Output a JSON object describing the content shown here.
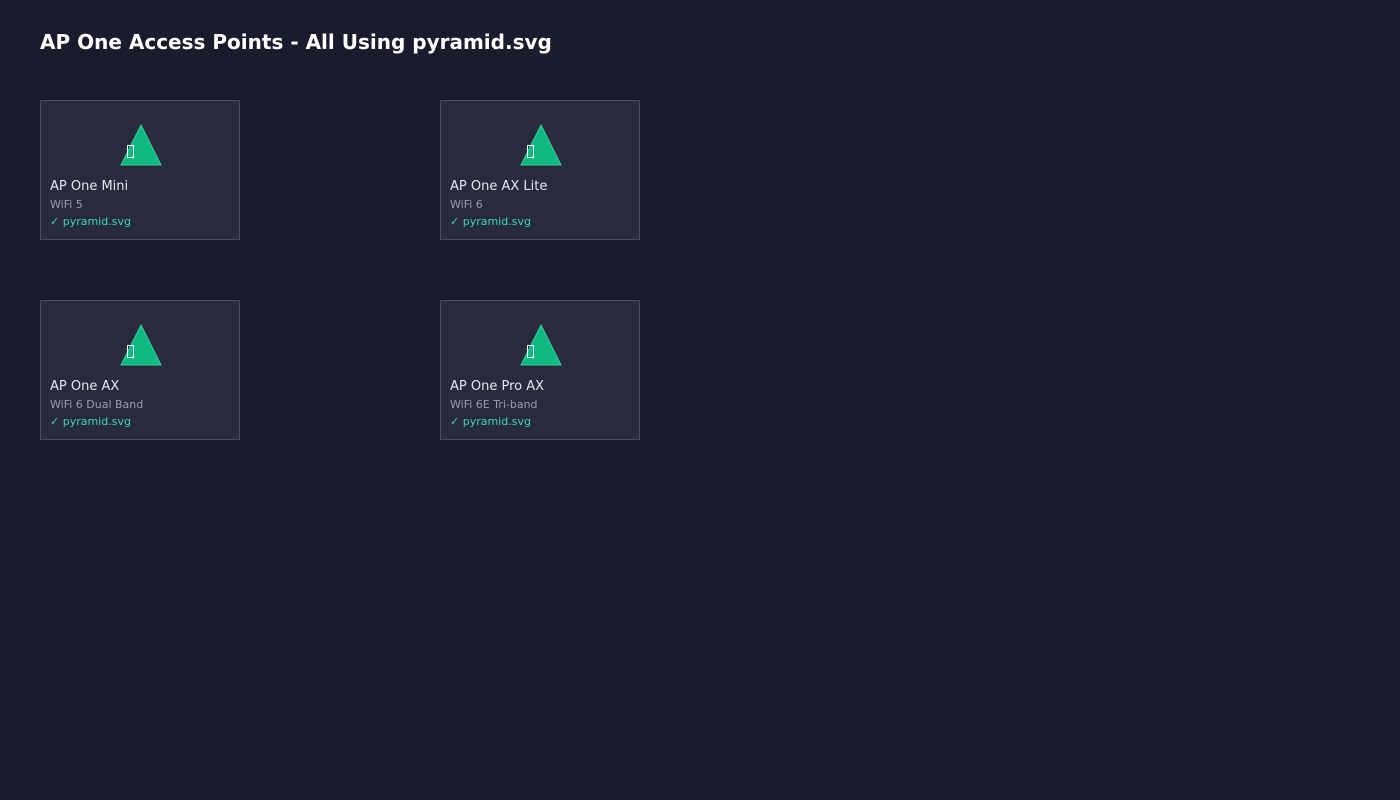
{
  "page": {
    "title": "AP One Access Points - All Using pyramid.svg"
  },
  "colors": {
    "background": "#1b1b2e",
    "card_background": "#282a3d",
    "card_border": "#4a4c66",
    "pyramid_fill": "#10b981",
    "check_text": "#3fd6b0"
  },
  "devices": [
    {
      "name": "AP One Mini",
      "spec": "WiFi 5",
      "file": "✓ pyramid.svg",
      "icon": "pyramid-icon"
    },
    {
      "name": "AP One AX Lite",
      "spec": "WiFi 6",
      "file": "✓ pyramid.svg",
      "icon": "pyramid-icon"
    },
    {
      "name": "AP One AX",
      "spec": "WiFi 6 Dual Band",
      "file": "✓ pyramid.svg",
      "icon": "pyramid-icon"
    },
    {
      "name": "AP One Pro AX",
      "spec": "WiFi 6E Tri-band",
      "file": "✓ pyramid.svg",
      "icon": "pyramid-icon"
    }
  ]
}
